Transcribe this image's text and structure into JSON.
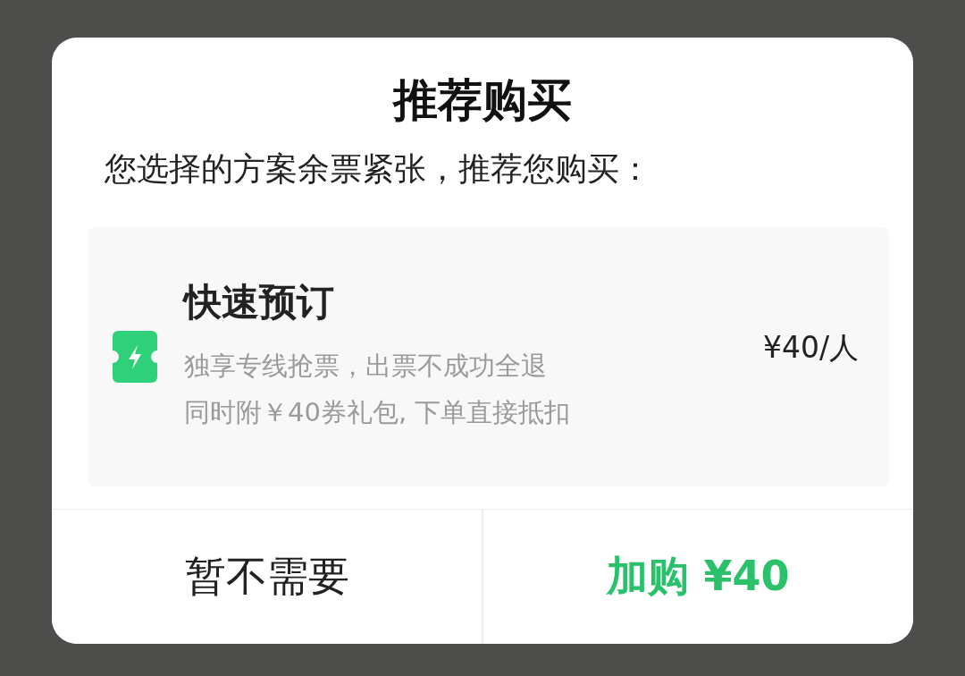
{
  "dialog": {
    "title": "推荐购买",
    "message": "您选择的方案余票紧张，推荐您购买：",
    "option": {
      "name": "快速预订",
      "lines": [
        "独享专线抢票，出票不成功全退",
        "同时附￥40券礼包, 下单直接抵扣"
      ],
      "price": "¥40/人"
    },
    "buttons": [
      {
        "label": "暂不需要",
        "kind": "secondary"
      },
      {
        "label": "加购 ¥40",
        "kind": "primary"
      }
    ]
  }
}
